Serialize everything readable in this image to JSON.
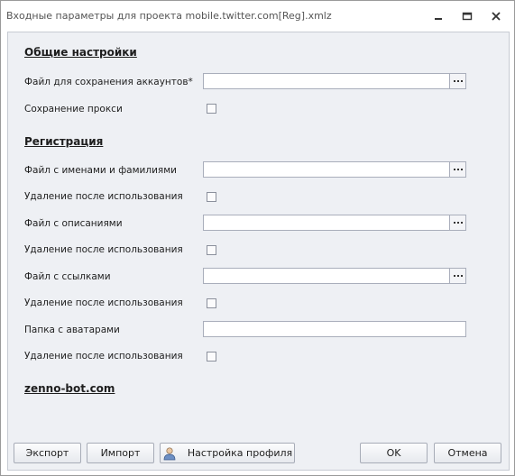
{
  "window": {
    "title": "Входные параметры для проекта mobile.twitter.com[Reg].xmlz"
  },
  "sections": {
    "general": "Общие настройки",
    "registration": "Регистрация",
    "footer_link": "zenno-bot.com"
  },
  "fields": {
    "accounts_file": {
      "label": "Файл для сохранения аккаунтов*",
      "value": ""
    },
    "save_proxy": {
      "label": "Сохранение прокси",
      "checked": false
    },
    "names_file": {
      "label": "Файл с именами и фамилиями",
      "value": ""
    },
    "names_delete": {
      "label": "Удаление после использования",
      "checked": false
    },
    "descriptions_file": {
      "label": "Файл с описаниями",
      "value": ""
    },
    "descriptions_delete": {
      "label": "Удаление после использования",
      "checked": false
    },
    "links_file": {
      "label": "Файл с ссылками",
      "value": ""
    },
    "links_delete": {
      "label": "Удаление после использования",
      "checked": false
    },
    "avatars_folder": {
      "label": "Папка с аватарами",
      "value": ""
    },
    "avatars_delete": {
      "label": "Удаление после использования",
      "checked": false
    }
  },
  "buttons": {
    "export": "Экспорт",
    "import": "Импорт",
    "profile_settings": "Настройка профиля",
    "ok": "OK",
    "cancel": "Отмена"
  },
  "icons": {
    "minimize": "minimize-icon",
    "restore": "restore-icon",
    "close": "close-icon",
    "browse": "ellipsis-icon",
    "profile": "user-profile-icon"
  }
}
